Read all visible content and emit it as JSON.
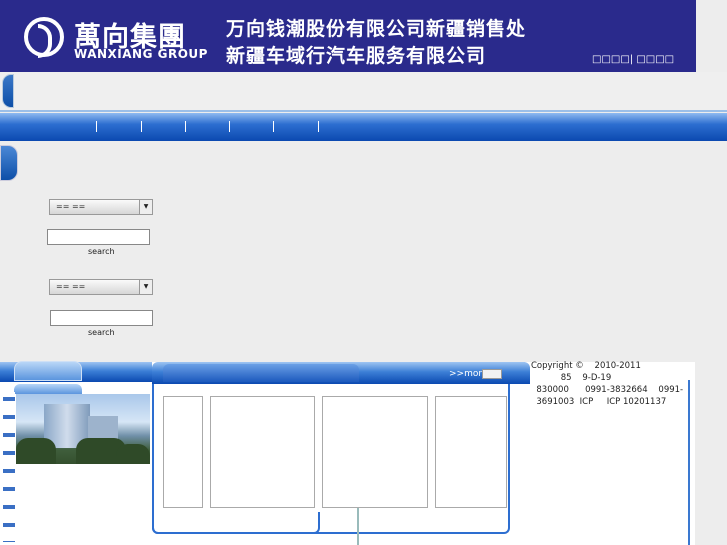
{
  "header": {
    "logo_cn": "萬向集團",
    "logo_en": "WANXIANG GROUP",
    "title_line1": "万向钱潮股份有限公司新疆销售处",
    "title_line2": "新疆车域行汽车服务有限公司",
    "top_links": "□□□□| □□□□"
  },
  "search1": {
    "select_value": "==   ==",
    "input_value": "",
    "button_label": "search"
  },
  "search2": {
    "select_value": "==   ==",
    "input_value": "",
    "button_label": "search"
  },
  "news": {
    "more_label": ">>more"
  },
  "footer": {
    "line1": "Copyright ©    2010-2011",
    "line2": "           85    9-D-19",
    "line3": "  830000      0991-3832664    0991-",
    "line4": "  3691003  ICP     ICP 10201137"
  },
  "colors": {
    "header_bg": "#2a2a8c",
    "nav_blue": "#0b49b0",
    "page_bg": "#ededed"
  }
}
